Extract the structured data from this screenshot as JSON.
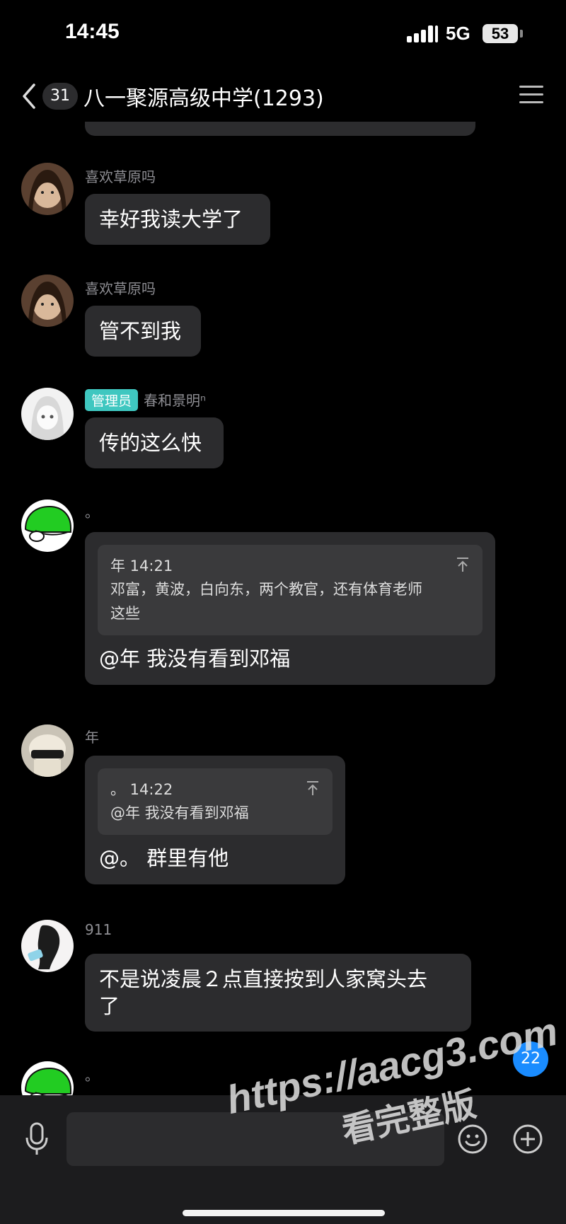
{
  "status_bar": {
    "time": "14:45",
    "network": "5G",
    "battery": "53"
  },
  "header": {
    "unread_count": "31",
    "title": "八一聚源高级中学(1293)"
  },
  "messages": [
    {
      "sender": "喜欢草原吗",
      "text": "幸好我读大学了"
    },
    {
      "sender": "喜欢草原吗",
      "text": "管不到我"
    },
    {
      "badge": "管理员",
      "sender": "春和景明ⁿ",
      "text": "传的这么快"
    },
    {
      "sender": "。",
      "quote": {
        "author_time": "年 14:21",
        "lines": [
          "邓富，黄波，白向东，两个教官，还有体育老师",
          "这些"
        ]
      },
      "text": "@年 我没有看到邓福"
    },
    {
      "sender": "年",
      "quote": {
        "author_time": "。 14:22",
        "lines": [
          "@年 我没有看到邓福"
        ]
      },
      "text": "@。 群里有他"
    },
    {
      "sender": "911",
      "text_lines": [
        "不是说凌晨２点直接按到人家窝头去",
        "了"
      ]
    },
    {
      "sender": "。"
    }
  ],
  "floating_unread": "22",
  "input": {
    "placeholder": ""
  },
  "watermark": {
    "url": "https://aacg3.com",
    "caption": "看完整版"
  },
  "colors": {
    "background": "#000000",
    "bubble": "#2c2c2e",
    "admin_badge": "#3fc7c0",
    "unread_badge": "#1a8cff"
  }
}
